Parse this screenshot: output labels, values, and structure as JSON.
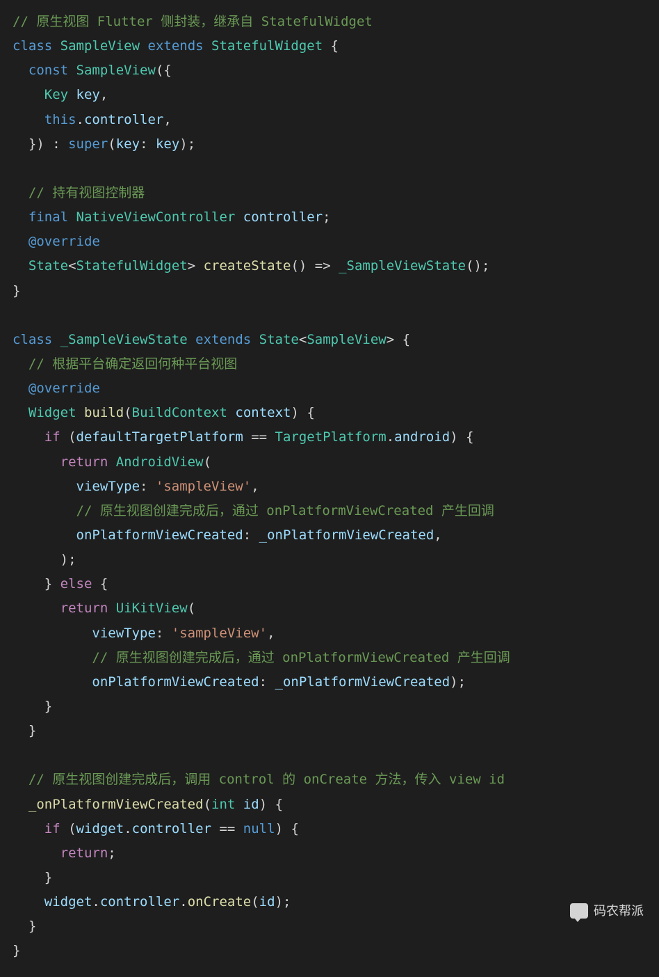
{
  "code": {
    "tokens": [
      [
        [
          "comment",
          "// 原生视图 Flutter 侧封装，继承自 StatefulWidget"
        ]
      ],
      [
        [
          "keyword",
          "class"
        ],
        [
          "punct",
          " "
        ],
        [
          "class",
          "SampleView"
        ],
        [
          "punct",
          " "
        ],
        [
          "keyword",
          "extends"
        ],
        [
          "punct",
          " "
        ],
        [
          "class",
          "StatefulWidget"
        ],
        [
          "punct",
          " {"
        ]
      ],
      [
        [
          "punct",
          "  "
        ],
        [
          "keyword",
          "const"
        ],
        [
          "punct",
          " "
        ],
        [
          "class",
          "SampleView"
        ],
        [
          "punct",
          "({"
        ]
      ],
      [
        [
          "punct",
          "    "
        ],
        [
          "type",
          "Key"
        ],
        [
          "punct",
          " "
        ],
        [
          "param",
          "key"
        ],
        [
          "punct",
          ","
        ]
      ],
      [
        [
          "punct",
          "    "
        ],
        [
          "keyword",
          "this"
        ],
        [
          "punct",
          "."
        ],
        [
          "param",
          "controller"
        ],
        [
          "punct",
          ","
        ]
      ],
      [
        [
          "punct",
          "  }) : "
        ],
        [
          "keyword",
          "super"
        ],
        [
          "punct",
          "("
        ],
        [
          "param",
          "key"
        ],
        [
          "punct",
          ": "
        ],
        [
          "param",
          "key"
        ],
        [
          "punct",
          ");"
        ]
      ],
      [
        [
          "punct",
          ""
        ]
      ],
      [
        [
          "punct",
          "  "
        ],
        [
          "comment",
          "// 持有视图控制器"
        ]
      ],
      [
        [
          "punct",
          "  "
        ],
        [
          "keyword",
          "final"
        ],
        [
          "punct",
          " "
        ],
        [
          "type",
          "NativeViewController"
        ],
        [
          "punct",
          " "
        ],
        [
          "param",
          "controller"
        ],
        [
          "punct",
          ";"
        ]
      ],
      [
        [
          "punct",
          "  "
        ],
        [
          "annot",
          "@override"
        ]
      ],
      [
        [
          "punct",
          "  "
        ],
        [
          "type",
          "State"
        ],
        [
          "punct",
          "<"
        ],
        [
          "type",
          "StatefulWidget"
        ],
        [
          "punct",
          "> "
        ],
        [
          "method",
          "createState"
        ],
        [
          "punct",
          "() => "
        ],
        [
          "class",
          "_SampleViewState"
        ],
        [
          "punct",
          "();"
        ]
      ],
      [
        [
          "punct",
          "}"
        ]
      ],
      [
        [
          "punct",
          ""
        ]
      ],
      [
        [
          "keyword",
          "class"
        ],
        [
          "punct",
          " "
        ],
        [
          "class",
          "_SampleViewState"
        ],
        [
          "punct",
          " "
        ],
        [
          "keyword",
          "extends"
        ],
        [
          "punct",
          " "
        ],
        [
          "class",
          "State"
        ],
        [
          "punct",
          "<"
        ],
        [
          "class",
          "SampleView"
        ],
        [
          "punct",
          "> {"
        ]
      ],
      [
        [
          "punct",
          "  "
        ],
        [
          "comment",
          "// 根据平台确定返回何种平台视图"
        ]
      ],
      [
        [
          "punct",
          "  "
        ],
        [
          "annot",
          "@override"
        ]
      ],
      [
        [
          "punct",
          "  "
        ],
        [
          "type",
          "Widget"
        ],
        [
          "punct",
          " "
        ],
        [
          "method",
          "build"
        ],
        [
          "punct",
          "("
        ],
        [
          "type",
          "BuildContext"
        ],
        [
          "punct",
          " "
        ],
        [
          "param",
          "context"
        ],
        [
          "punct",
          ") {"
        ]
      ],
      [
        [
          "punct",
          "    "
        ],
        [
          "ctrl",
          "if"
        ],
        [
          "punct",
          " ("
        ],
        [
          "param",
          "defaultTargetPlatform"
        ],
        [
          "punct",
          " == "
        ],
        [
          "class",
          "TargetPlatform"
        ],
        [
          "punct",
          "."
        ],
        [
          "param",
          "android"
        ],
        [
          "punct",
          ") {"
        ]
      ],
      [
        [
          "punct",
          "      "
        ],
        [
          "ctrl",
          "return"
        ],
        [
          "punct",
          " "
        ],
        [
          "class",
          "AndroidView"
        ],
        [
          "punct",
          "("
        ]
      ],
      [
        [
          "punct",
          "        "
        ],
        [
          "param",
          "viewType"
        ],
        [
          "punct",
          ": "
        ],
        [
          "string",
          "'sampleView'"
        ],
        [
          "punct",
          ","
        ]
      ],
      [
        [
          "punct",
          "        "
        ],
        [
          "comment",
          "// 原生视图创建完成后，通过 onPlatformViewCreated 产生回调"
        ]
      ],
      [
        [
          "punct",
          "        "
        ],
        [
          "param",
          "onPlatformViewCreated"
        ],
        [
          "punct",
          ": "
        ],
        [
          "param",
          "_onPlatformViewCreated"
        ],
        [
          "punct",
          ","
        ]
      ],
      [
        [
          "punct",
          "      );"
        ]
      ],
      [
        [
          "punct",
          "    } "
        ],
        [
          "ctrl",
          "else"
        ],
        [
          "punct",
          " {"
        ]
      ],
      [
        [
          "punct",
          "      "
        ],
        [
          "ctrl",
          "return"
        ],
        [
          "punct",
          " "
        ],
        [
          "class",
          "UiKitView"
        ],
        [
          "punct",
          "("
        ]
      ],
      [
        [
          "punct",
          "          "
        ],
        [
          "param",
          "viewType"
        ],
        [
          "punct",
          ": "
        ],
        [
          "string",
          "'sampleView'"
        ],
        [
          "punct",
          ","
        ]
      ],
      [
        [
          "punct",
          "          "
        ],
        [
          "comment",
          "// 原生视图创建完成后，通过 onPlatformViewCreated 产生回调"
        ]
      ],
      [
        [
          "punct",
          "          "
        ],
        [
          "param",
          "onPlatformViewCreated"
        ],
        [
          "punct",
          ": "
        ],
        [
          "param",
          "_onPlatformViewCreated"
        ],
        [
          "punct",
          ");"
        ]
      ],
      [
        [
          "punct",
          "    }"
        ]
      ],
      [
        [
          "punct",
          "  }"
        ]
      ],
      [
        [
          "punct",
          ""
        ]
      ],
      [
        [
          "punct",
          "  "
        ],
        [
          "comment",
          "// 原生视图创建完成后，调用 control 的 onCreate 方法，传入 view id"
        ]
      ],
      [
        [
          "punct",
          "  "
        ],
        [
          "method",
          "_onPlatformViewCreated"
        ],
        [
          "punct",
          "("
        ],
        [
          "type",
          "int"
        ],
        [
          "punct",
          " "
        ],
        [
          "param",
          "id"
        ],
        [
          "punct",
          ") {"
        ]
      ],
      [
        [
          "punct",
          "    "
        ],
        [
          "ctrl",
          "if"
        ],
        [
          "punct",
          " ("
        ],
        [
          "param",
          "widget"
        ],
        [
          "punct",
          "."
        ],
        [
          "param",
          "controller"
        ],
        [
          "punct",
          " == "
        ],
        [
          "null",
          "null"
        ],
        [
          "punct",
          ") {"
        ]
      ],
      [
        [
          "punct",
          "      "
        ],
        [
          "ctrl",
          "return"
        ],
        [
          "punct",
          ";"
        ]
      ],
      [
        [
          "punct",
          "    }"
        ]
      ],
      [
        [
          "punct",
          "    "
        ],
        [
          "param",
          "widget"
        ],
        [
          "punct",
          "."
        ],
        [
          "param",
          "controller"
        ],
        [
          "punct",
          "."
        ],
        [
          "method",
          "onCreate"
        ],
        [
          "punct",
          "("
        ],
        [
          "param",
          "id"
        ],
        [
          "punct",
          ");"
        ]
      ],
      [
        [
          "punct",
          "  }"
        ]
      ],
      [
        [
          "punct",
          "}"
        ]
      ]
    ]
  },
  "watermark": {
    "text": "码农帮派"
  }
}
